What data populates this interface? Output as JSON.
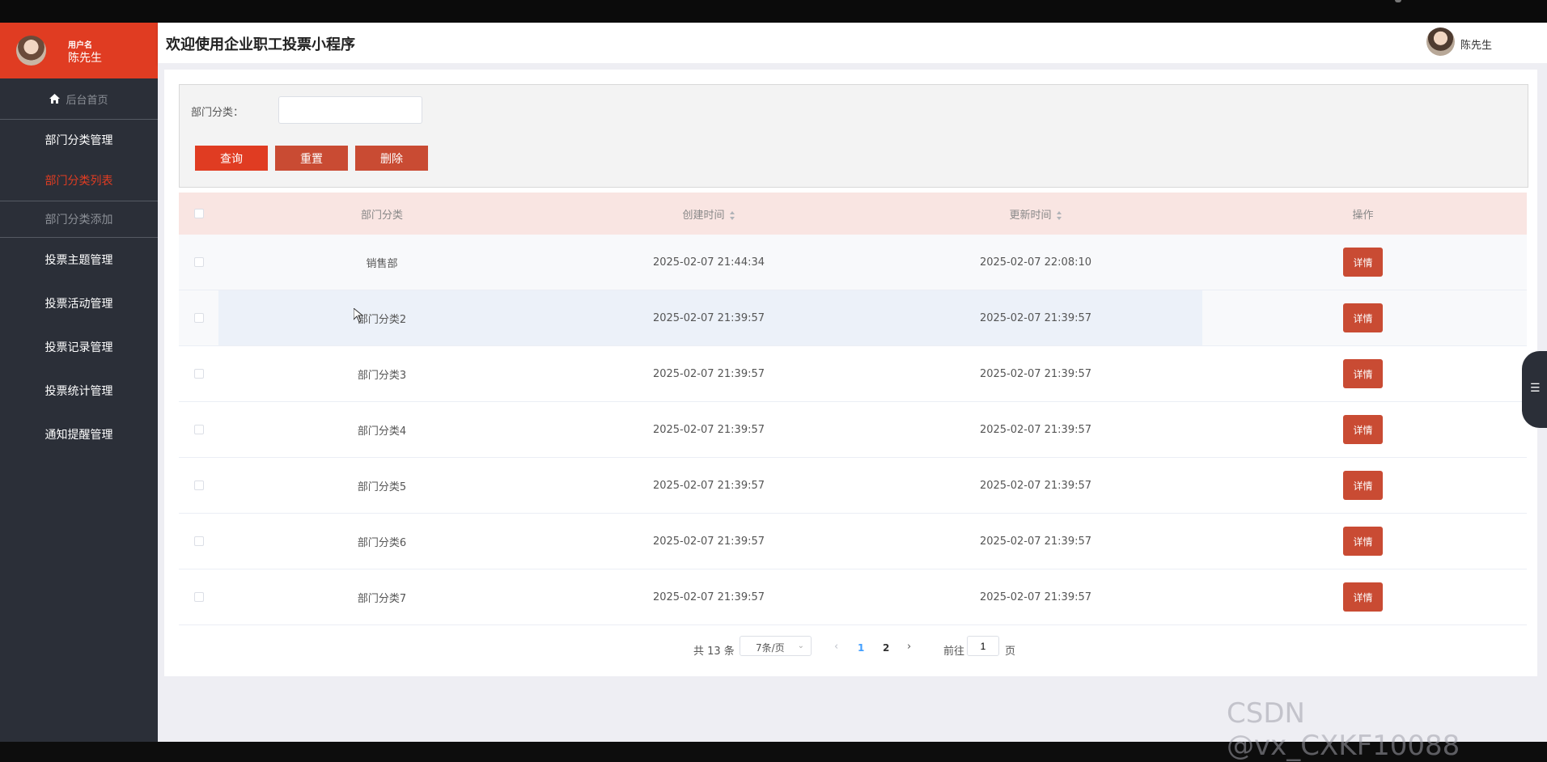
{
  "sidebar": {
    "user_label": "用户名",
    "user_name": "陈先生",
    "home": "后台首页",
    "group_dept": "部门分类管理",
    "dept_list": "部门分类列表",
    "dept_add": "部门分类添加",
    "items": [
      "投票主题管理",
      "投票活动管理",
      "投票记录管理",
      "投票统计管理",
      "通知提醒管理"
    ]
  },
  "header": {
    "title": "欢迎使用企业职工投票小程序",
    "user": "陈先生"
  },
  "search": {
    "label": "部门分类：",
    "value": "",
    "query_btn": "查询",
    "reset_btn": "重置",
    "delete_btn": "删除"
  },
  "table": {
    "headers": [
      "部门分类",
      "创建时间",
      "更新时间",
      "操作"
    ],
    "detail_label": "详情",
    "rows": [
      {
        "category": "销售部",
        "created": "2025-02-07 21:44:34",
        "updated": "2025-02-07 22:08:10"
      },
      {
        "category": "部门分类2",
        "created": "2025-02-07 21:39:57",
        "updated": "2025-02-07 21:39:57"
      },
      {
        "category": "部门分类3",
        "created": "2025-02-07 21:39:57",
        "updated": "2025-02-07 21:39:57"
      },
      {
        "category": "部门分类4",
        "created": "2025-02-07 21:39:57",
        "updated": "2025-02-07 21:39:57"
      },
      {
        "category": "部门分类5",
        "created": "2025-02-07 21:39:57",
        "updated": "2025-02-07 21:39:57"
      },
      {
        "category": "部门分类6",
        "created": "2025-02-07 21:39:57",
        "updated": "2025-02-07 21:39:57"
      },
      {
        "category": "部门分类7",
        "created": "2025-02-07 21:39:57",
        "updated": "2025-02-07 21:39:57"
      }
    ]
  },
  "pager": {
    "total": "共 13 条",
    "page_size": "7条/页",
    "pages": [
      "1",
      "2"
    ],
    "goto_label": "前往",
    "goto_value": "1",
    "page_unit": "页"
  },
  "watermark": "CSDN @vx_CXKF10088",
  "colors": {
    "accent": "#e03c22",
    "button": "#c94b33",
    "sidebar": "#2b2f38",
    "table_header": "#f9e5e2"
  }
}
